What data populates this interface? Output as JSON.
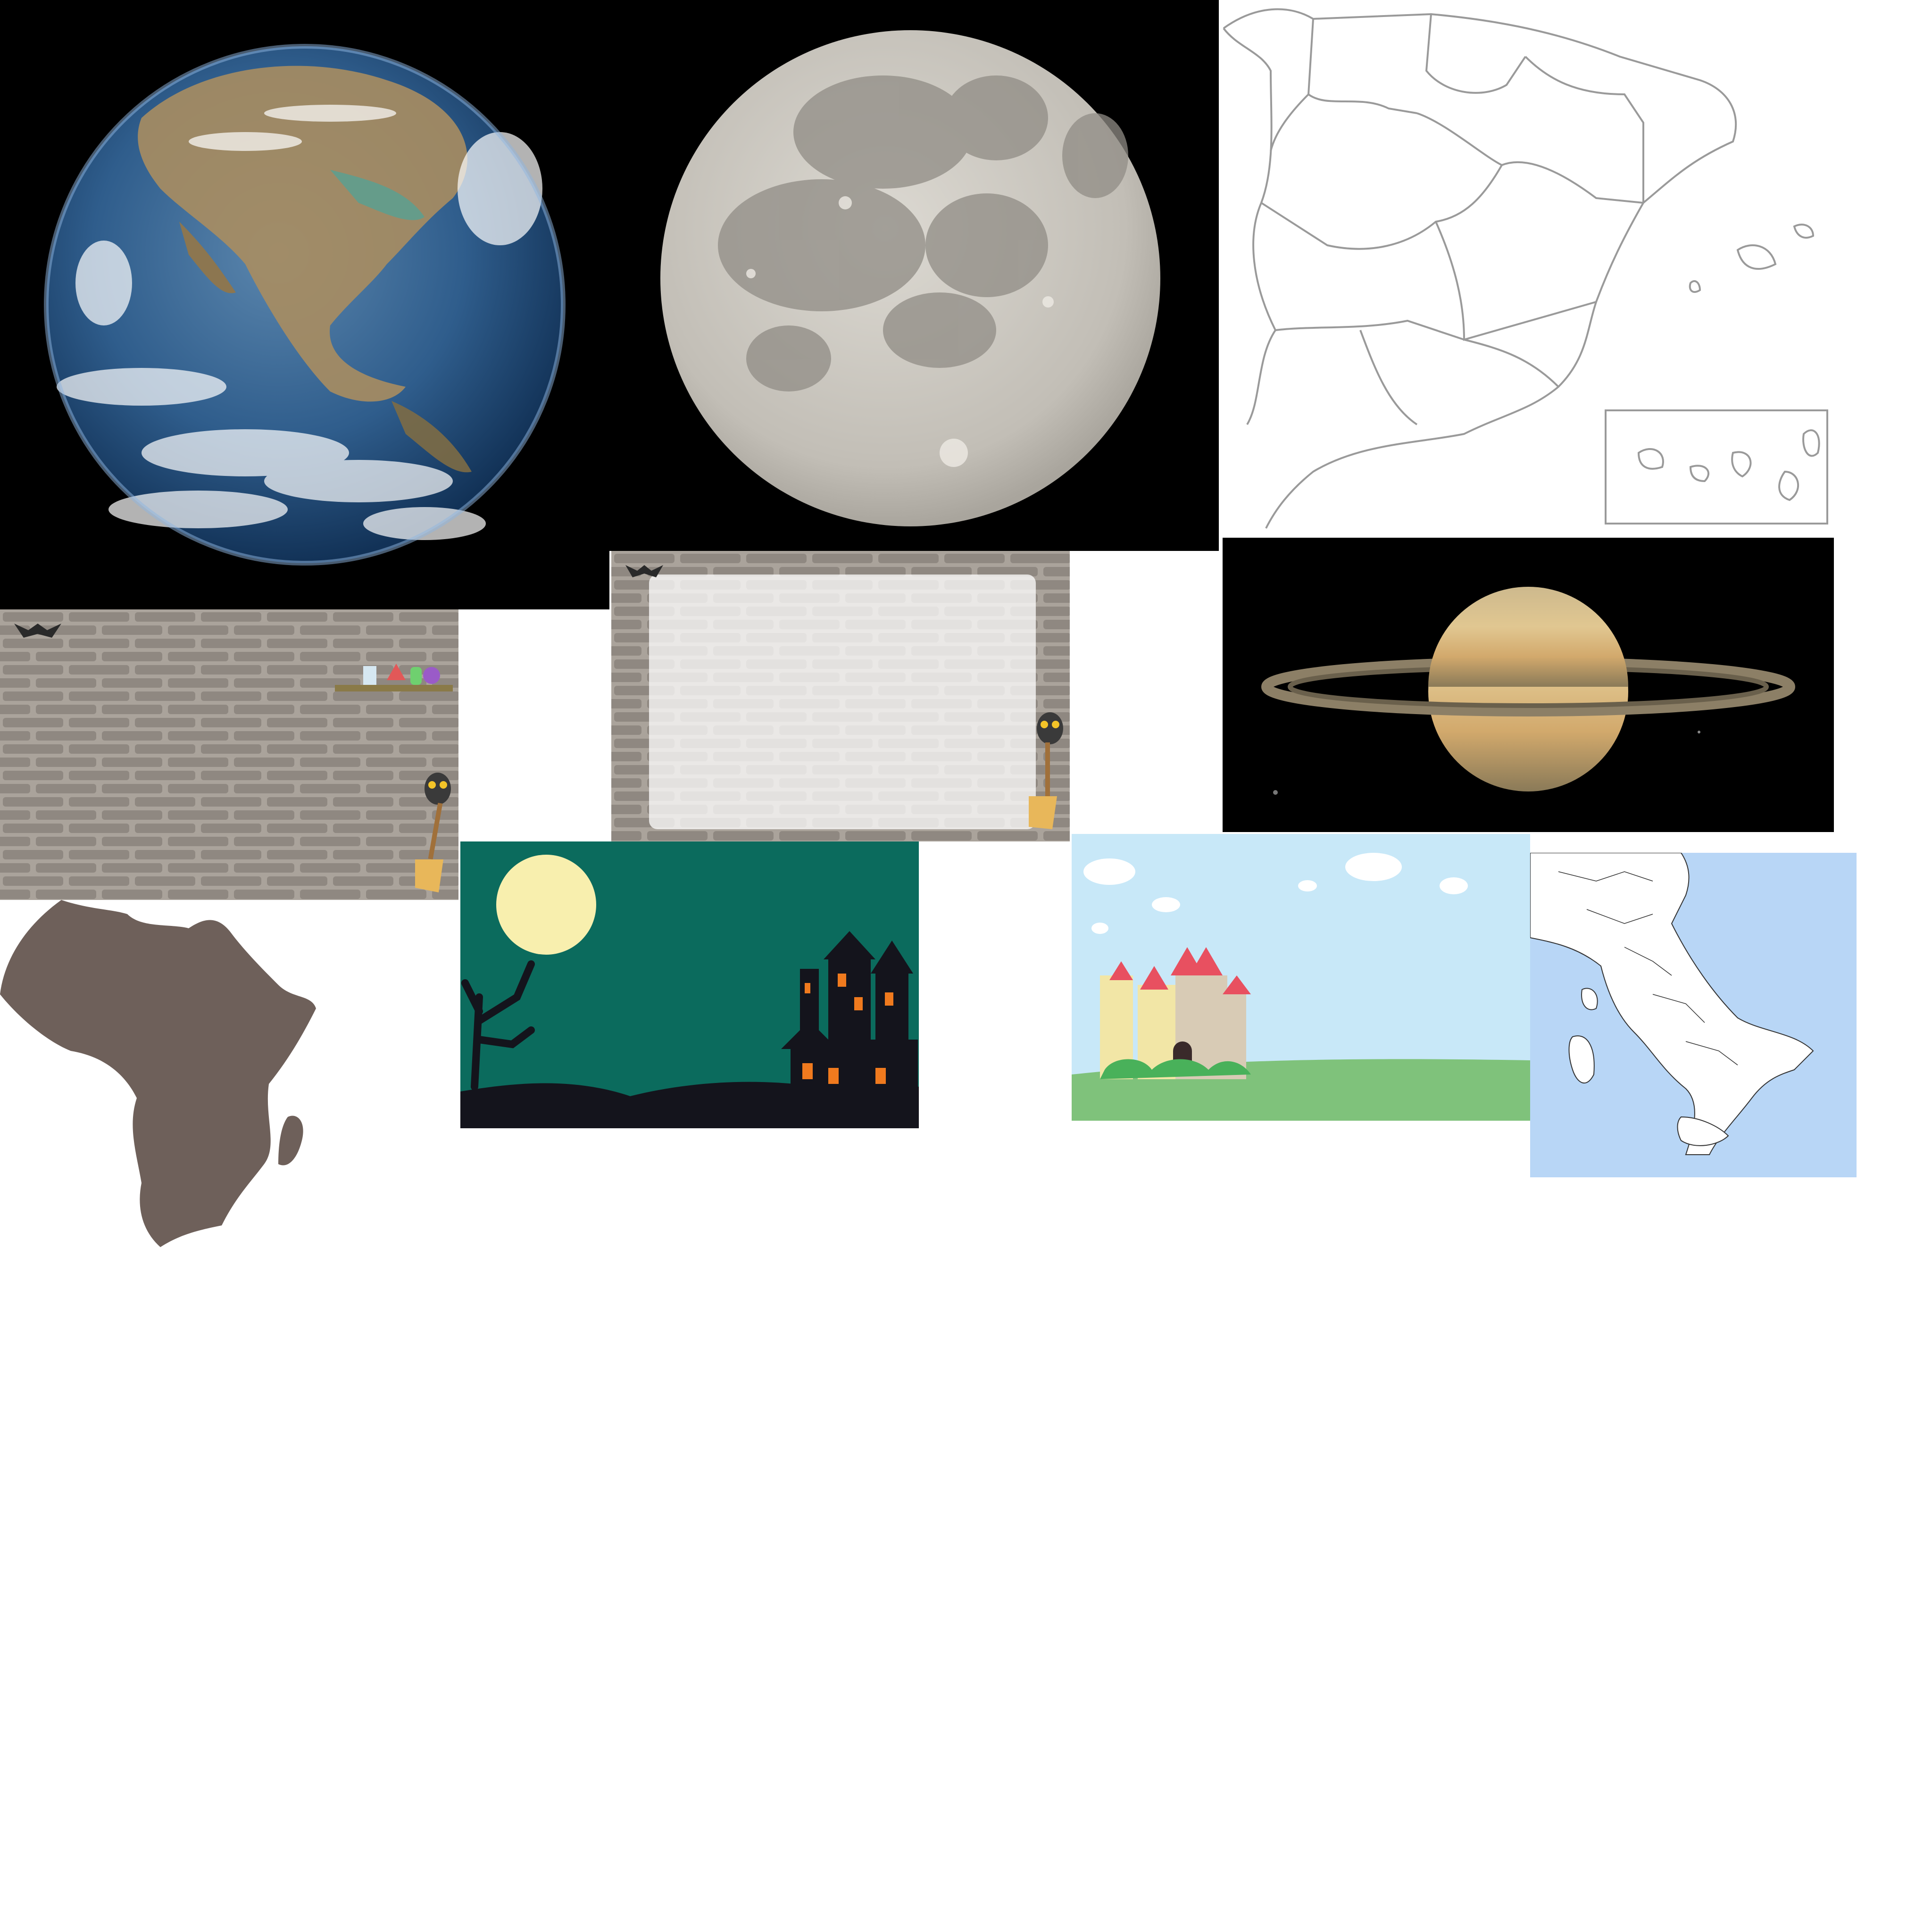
{
  "sheet": {
    "background": "#ffffff",
    "tiles": [
      {
        "id": "earth-photo",
        "icon": "earth-icon"
      },
      {
        "id": "moon-photo",
        "icon": "moon-icon"
      },
      {
        "id": "spain-region-map",
        "icon": "map-icon"
      },
      {
        "id": "brick-wall-background",
        "icon": "bat-icon"
      },
      {
        "id": "brick-wall-panel-background",
        "icon": "owl-icon"
      },
      {
        "id": "saturn-photo",
        "icon": "saturn-icon"
      },
      {
        "id": "haunted-night-background",
        "icon": "haunted-house-icon"
      },
      {
        "id": "castle-meadow-background",
        "icon": "castle-icon"
      },
      {
        "id": "italy-region-map",
        "icon": "map-icon"
      },
      {
        "id": "africa-silhouette",
        "icon": "continent-icon"
      }
    ]
  },
  "colors": {
    "space": "#000000",
    "ocean": "#2a5a8a",
    "moon": "#c9c6bf",
    "map_line": "#9a9a9a",
    "brick_wall": "#aaa39b",
    "brick": "#8f8881",
    "haunted_sky": "#0b6b5d",
    "haunted_ground": "#14141c",
    "moon_yellow": "#f8efae",
    "window_orange": "#f07a1e",
    "castle_sky": "#c8e8f8",
    "meadow": "#7fc27b",
    "castle_wall": "#f2e6a6",
    "roof_red": "#e85060",
    "sea_blue": "#b8d6f6",
    "africa": "#6e605a",
    "saturn_body": "#d9c08a"
  }
}
